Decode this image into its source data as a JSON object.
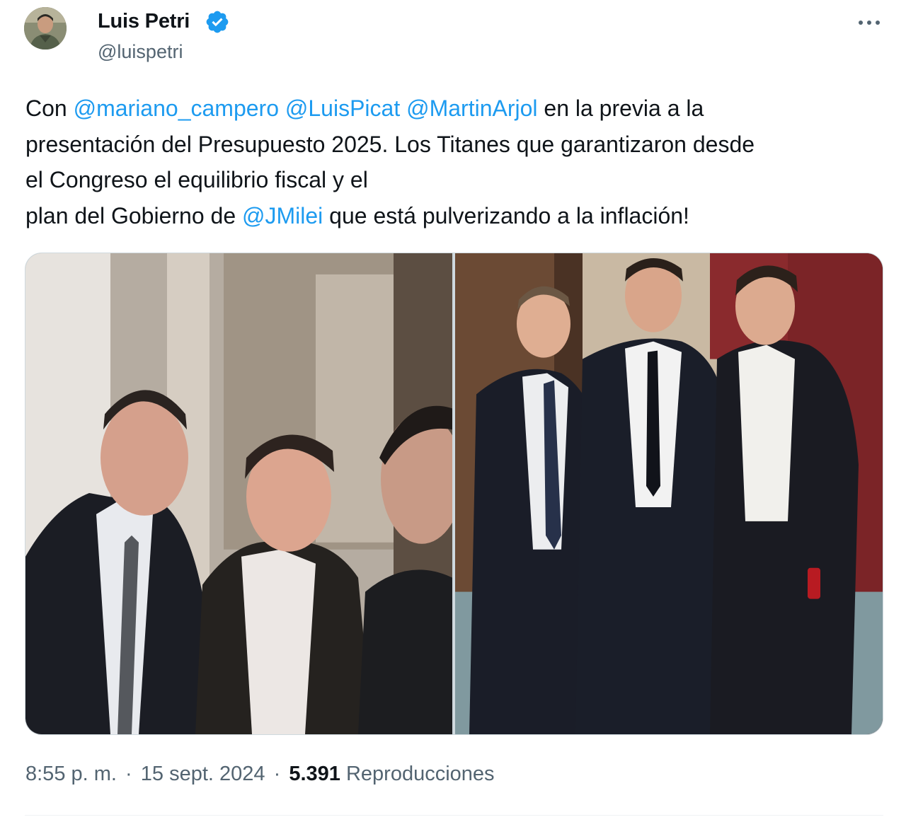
{
  "author": {
    "display_name": "Luis Petri",
    "handle": "@luispetri",
    "verified_icon": "verified-badge-icon",
    "avatar_icon": "avatar-image"
  },
  "more_icon": "more-options-icon",
  "tweet": {
    "lines": [
      [
        {
          "text": "Con "
        },
        {
          "text": "@mariano_campero",
          "mention": true
        },
        {
          "text": " "
        },
        {
          "text": "@LuisPicat",
          "mention": true
        },
        {
          "text": " "
        },
        {
          "text": "@MartinArjol",
          "mention": true
        },
        {
          "text": " en la previa a la"
        }
      ],
      [
        {
          "text": "presentación del Presupuesto 2025. Los Titanes que garantizaron desde"
        }
      ],
      [
        {
          "text": "el Congreso el equilibrio fiscal y el"
        }
      ],
      [
        {
          "text": "plan del Gobierno de "
        },
        {
          "text": "@JMilei",
          "mention": true
        },
        {
          "text": " que está pulverizando a la inflación!"
        }
      ]
    ]
  },
  "media": {
    "photos": [
      "photo-selfie-three-men",
      "photo-three-men-standing"
    ]
  },
  "meta": {
    "time": "8:55 p. m.",
    "separator": "·",
    "date": "15 sept. 2024",
    "views_count": "5.391",
    "views_label": "Reproducciones"
  },
  "colors": {
    "link": "#1d9bf0",
    "text": "#0f1419",
    "secondary": "#536471",
    "verified": "#1d9bf0"
  }
}
